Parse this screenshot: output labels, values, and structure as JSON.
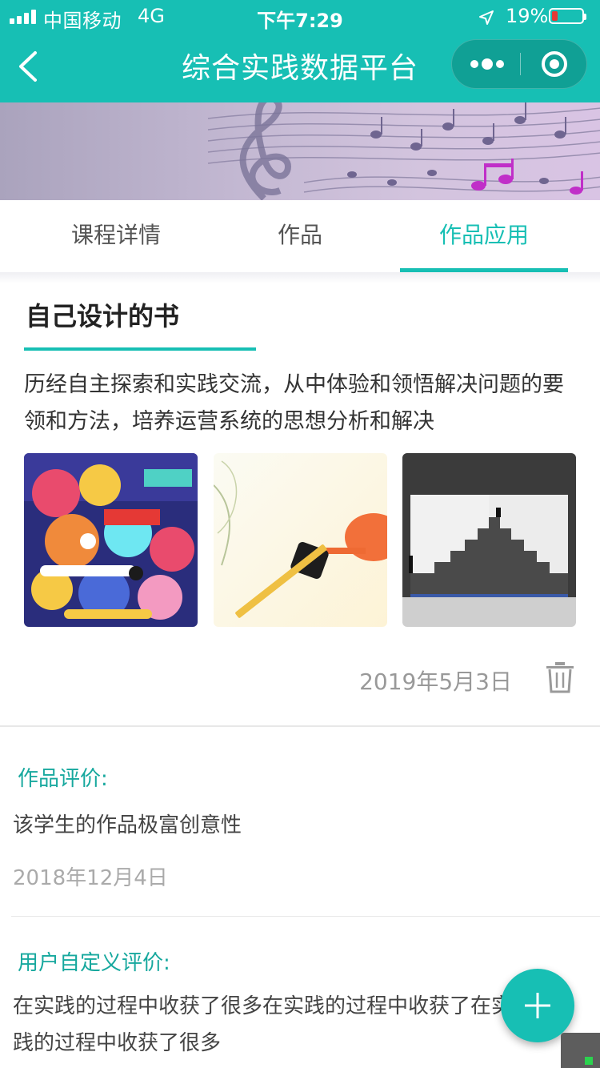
{
  "status_bar": {
    "carrier": "中国移动",
    "network": "4G",
    "time": "下午7:29",
    "battery_percent": "19%",
    "battery_level": 0.19
  },
  "nav": {
    "title": "综合实践数据平台",
    "back_icon": "chevron-left-icon",
    "more_icon": "more-dots-icon",
    "close_icon": "target-circle-icon"
  },
  "banner": {
    "icon": "music-notes-illustration"
  },
  "tabs": [
    {
      "label": "课程详情",
      "active": false
    },
    {
      "label": "作品",
      "active": false
    },
    {
      "label": "作品应用",
      "active": true
    }
  ],
  "work": {
    "title": "自己设计的书",
    "description": "历经自主探索和实践交流，从中体验和领悟解决问题的要领和方法，培养运营系统的思想分析和解决",
    "images": [
      {
        "alt": "colorful-illustration-poster"
      },
      {
        "alt": "eraser-and-pencil-photo"
      },
      {
        "alt": "staircase-book-spread"
      }
    ],
    "date": "2019年5月3日",
    "delete_icon": "trash-icon"
  },
  "evaluation": {
    "label": "作品评价:",
    "text": "该学生的作品极富创意性",
    "date": "2018年12月4日"
  },
  "custom_evaluation": {
    "label": "用户自定义评价:",
    "text": "在实践的过程中收获了很多在实践的过程中收获了在实践的过程中收获了很多"
  },
  "fab": {
    "icon": "plus-icon"
  },
  "colors": {
    "accent": "#17bfb4",
    "label_teal": "#17a89e",
    "battery_low": "#e53935"
  }
}
